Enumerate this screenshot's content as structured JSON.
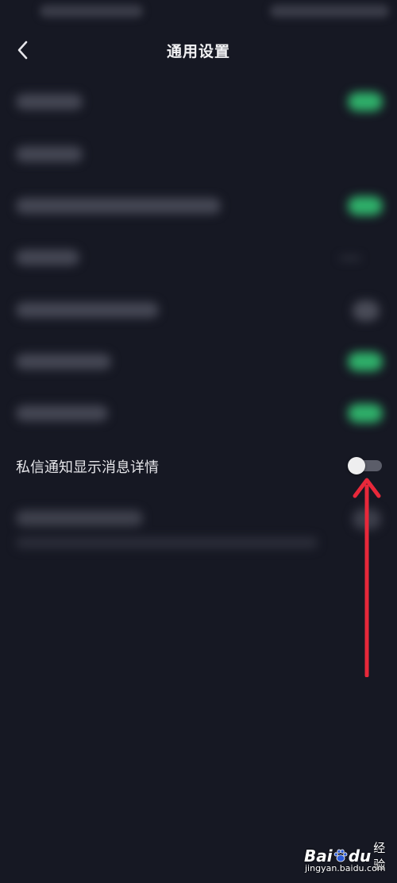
{
  "header": {
    "title": "通用设置"
  },
  "highlighted_setting": {
    "label": "私信通知显示消息详情",
    "enabled": false
  },
  "colors": {
    "background": "#161823",
    "toggle_on": "#2fb06a",
    "toggle_off_track": "#5b5d69",
    "annotation_arrow": "#e8283a"
  },
  "watermark": {
    "brand_left": "Bai",
    "brand_right": "du",
    "product": "经验",
    "url": "jingyan.baidu.com"
  }
}
